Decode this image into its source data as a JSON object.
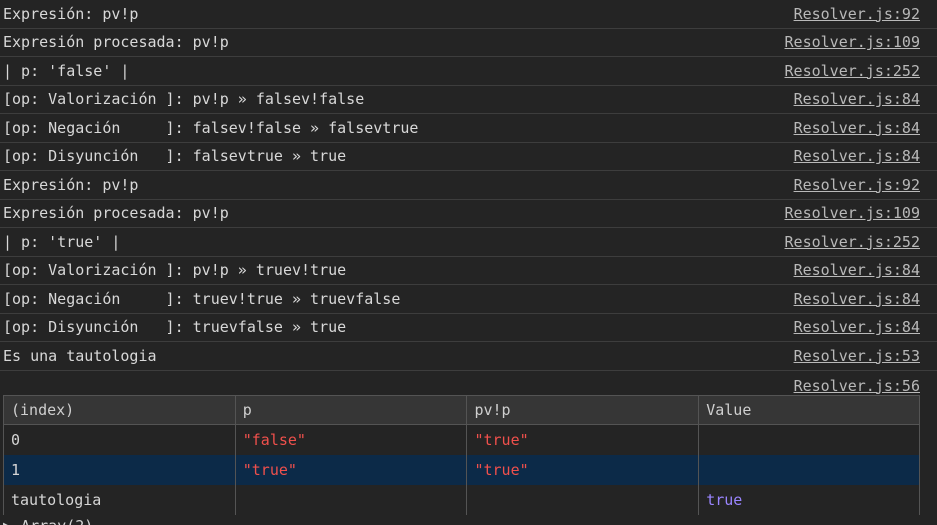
{
  "logs": [
    {
      "msg": "Expresión: pv!p",
      "src": "Resolver.js:92"
    },
    {
      "msg": "Expresión procesada: pv!p",
      "src": "Resolver.js:109"
    },
    {
      "msg": "| p: 'false' |",
      "src": "Resolver.js:252"
    },
    {
      "msg": "[op: Valorización ]: pv!p » falsev!false",
      "src": "Resolver.js:84"
    },
    {
      "msg": "[op: Negación     ]: falsev!false » falsevtrue",
      "src": "Resolver.js:84"
    },
    {
      "msg": "[op: Disyunción   ]: falsevtrue » true",
      "src": "Resolver.js:84"
    },
    {
      "msg": "Expresión: pv!p",
      "src": "Resolver.js:92"
    },
    {
      "msg": "Expresión procesada: pv!p",
      "src": "Resolver.js:109"
    },
    {
      "msg": "| p: 'true' |",
      "src": "Resolver.js:252"
    },
    {
      "msg": "[op: Valorización ]: pv!p » truev!true",
      "src": "Resolver.js:84"
    },
    {
      "msg": "[op: Negación     ]: truev!true » truevfalse",
      "src": "Resolver.js:84"
    },
    {
      "msg": "[op: Disyunción   ]: truevfalse » true",
      "src": "Resolver.js:84"
    },
    {
      "msg": "Es una tautologia",
      "src": "Resolver.js:53"
    }
  ],
  "table_source": "Resolver.js:56",
  "table": {
    "headers": [
      "(index)",
      "p",
      "pv!p",
      "Value"
    ],
    "rows": [
      [
        "0",
        "\"false\"",
        "\"true\"",
        ""
      ],
      [
        "1",
        "\"true\"",
        "\"true\"",
        ""
      ],
      [
        "tautologia",
        "",
        "",
        "true"
      ]
    ]
  },
  "bottom_text": "▶ Array(2)",
  "colors": {
    "background": "#242424",
    "string_value": "#f0504c",
    "boolean_value": "#9a85ff",
    "selected_row": "#0c2a48"
  }
}
